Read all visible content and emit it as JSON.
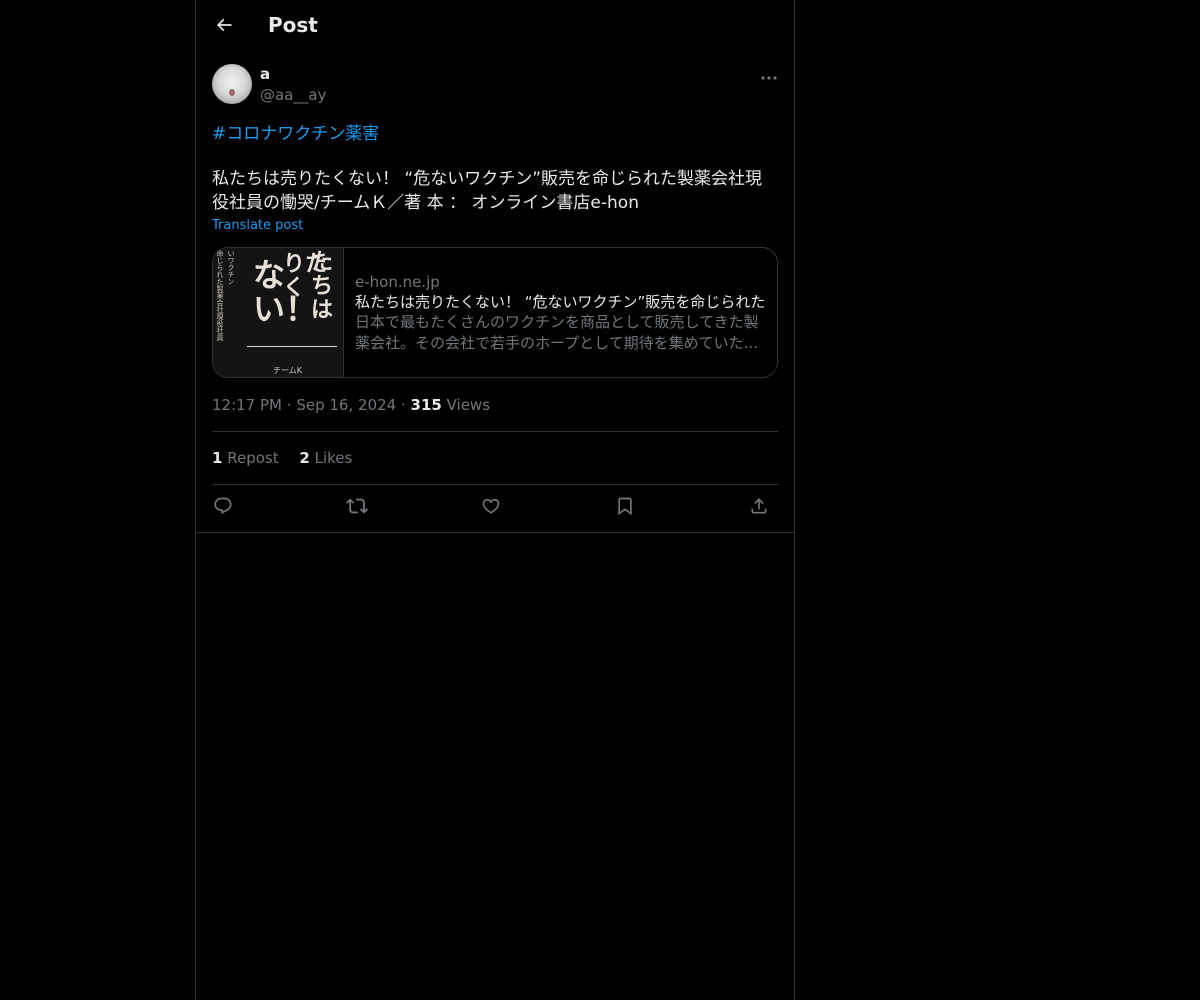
{
  "header": {
    "title": "Post",
    "back_icon": "back-arrow-icon"
  },
  "post": {
    "author": {
      "name": "a",
      "handle": "@aa__ay",
      "avatar": "avatar-image"
    },
    "more_icon": "more-dots-icon",
    "hashtag": "#コロナワクチン薬害",
    "text": "私たちは売りたくない！ “危ないワクチン”販売を命じられた製薬会社現役社員の慟哭/チームＫ／著 本 ： オンライン書店e-hon",
    "translate_label": "Translate post",
    "card": {
      "thumb_big_lines": [
        "たちは",
        "りたく",
        "ない！"
      ],
      "thumb_small_vertical": "いワクチン",
      "thumb_small_vertical_2": "命じられた製薬会社現役社員",
      "thumb_author": "チームK",
      "domain": "e-hon.ne.jp",
      "title": "私たちは売りたくない！ “危ないワクチン”販売を命じられた",
      "description": "日本で最もたくさんのワクチンを商品として販売してきた製薬会社。その会社で若手のホープとして期待を集めていた..."
    },
    "time": "12:17 PM",
    "date": "Sep 16, 2024",
    "separator": "·",
    "views_count": "315",
    "views_label": "Views",
    "stats": {
      "reposts_count": "1",
      "reposts_label": "Repost",
      "likes_count": "2",
      "likes_label": "Likes"
    },
    "actions": [
      {
        "name": "reply",
        "icon": "reply-icon"
      },
      {
        "name": "repost",
        "icon": "repost-icon"
      },
      {
        "name": "like",
        "icon": "heart-icon"
      },
      {
        "name": "bookmark",
        "icon": "bookmark-icon"
      },
      {
        "name": "share",
        "icon": "share-icon"
      }
    ]
  },
  "colors": {
    "background": "#000000",
    "text_primary": "#e7e9ea",
    "text_secondary": "#71767b",
    "accent": "#1d9bf0",
    "border": "#2f3336"
  }
}
